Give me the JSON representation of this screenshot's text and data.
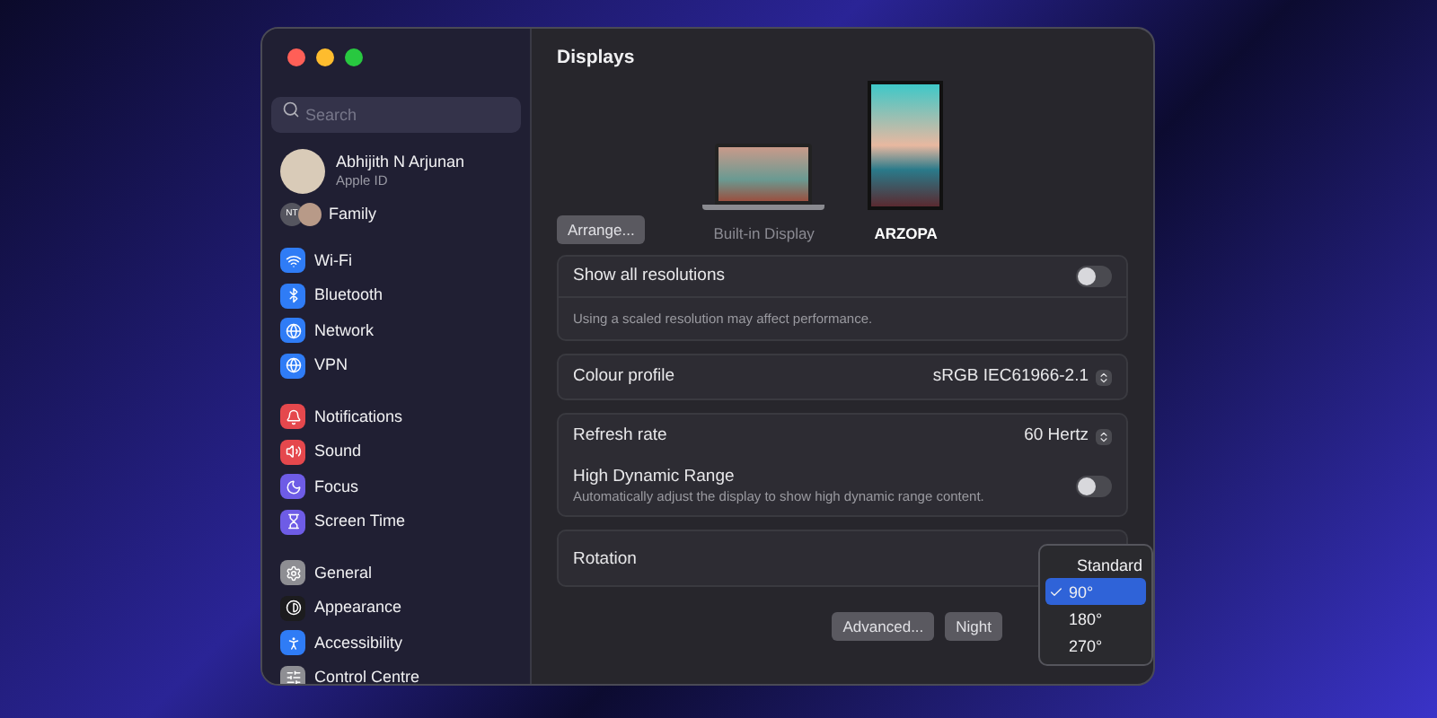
{
  "sidebar": {
    "search": {
      "placeholder": "Search"
    },
    "account": {
      "name": "Abhijith N Arjunan",
      "subtitle": "Apple ID"
    },
    "family": {
      "badge": "NT",
      "label": "Family"
    },
    "groups": [
      [
        {
          "label": "Wi-Fi",
          "color": "#2f7cf6"
        },
        {
          "label": "Bluetooth",
          "color": "#2f7cf6"
        },
        {
          "label": "Network",
          "color": "#2f7cf6"
        },
        {
          "label": "VPN",
          "color": "#2f7cf6"
        }
      ],
      [
        {
          "label": "Notifications",
          "color": "#e5484d"
        },
        {
          "label": "Sound",
          "color": "#e5484d"
        },
        {
          "label": "Focus",
          "color": "#6e5ce6"
        },
        {
          "label": "Screen Time",
          "color": "#6e5ce6"
        }
      ],
      [
        {
          "label": "General",
          "color": "#8e8e93"
        },
        {
          "label": "Appearance",
          "color": "#1c1c1e"
        },
        {
          "label": "Accessibility",
          "color": "#2f7cf6"
        },
        {
          "label": "Control Centre",
          "color": "#8e8e93"
        }
      ]
    ]
  },
  "main": {
    "title": "Displays",
    "arrange_button": "Arrange...",
    "displays": [
      {
        "name": "Built-in Display",
        "kind": "laptop",
        "selected": false
      },
      {
        "name": "ARZOPA",
        "kind": "monitor",
        "selected": true
      }
    ],
    "groups": [
      [
        {
          "kind": "toggle",
          "label": "Show all resolutions",
          "on": false
        },
        {
          "kind": "note",
          "text": "Using a scaled resolution may affect performance."
        }
      ],
      [
        {
          "kind": "select",
          "label": "Colour profile",
          "value": "sRGB IEC61966-2.1"
        }
      ],
      [
        {
          "kind": "select",
          "label": "Refresh rate",
          "value": "60 Hertz"
        },
        {
          "kind": "toggle",
          "label": "High Dynamic Range",
          "description": "Automatically adjust the display to show high dynamic range content.",
          "on": false
        }
      ],
      [
        {
          "kind": "label",
          "label": "Rotation"
        }
      ]
    ],
    "buttons": [
      "Advanced...",
      "Night"
    ],
    "rotation_menu": [
      {
        "label": "Standard",
        "selected": false
      },
      {
        "label": "90°",
        "selected": true
      },
      {
        "label": "180°",
        "selected": false
      },
      {
        "label": "270°",
        "selected": false
      }
    ]
  }
}
